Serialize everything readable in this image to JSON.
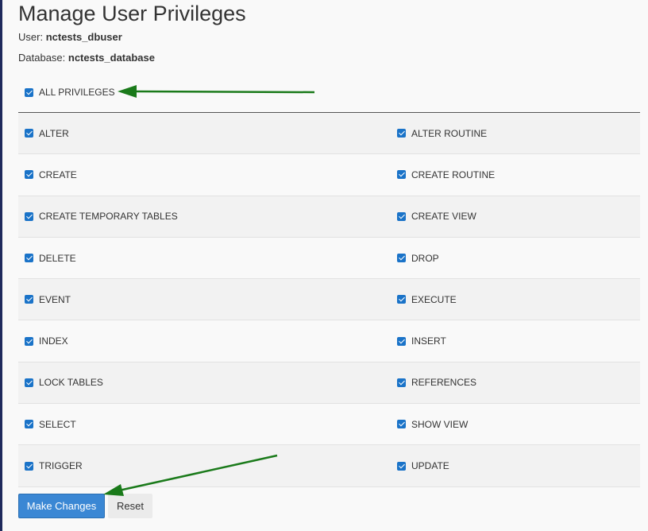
{
  "page": {
    "title": "Manage User Privileges",
    "user_label": "User:",
    "user_value": "nctests_dbuser",
    "database_label": "Database:",
    "database_value": "nctests_database"
  },
  "all_privileges": {
    "label": "ALL PRIVILEGES",
    "checked": true
  },
  "privileges": {
    "rows": [
      {
        "left": {
          "label": "ALTER",
          "checked": true
        },
        "right": {
          "label": "ALTER ROUTINE",
          "checked": true
        }
      },
      {
        "left": {
          "label": "CREATE",
          "checked": true
        },
        "right": {
          "label": "CREATE ROUTINE",
          "checked": true
        }
      },
      {
        "left": {
          "label": "CREATE TEMPORARY TABLES",
          "checked": true
        },
        "right": {
          "label": "CREATE VIEW",
          "checked": true
        }
      },
      {
        "left": {
          "label": "DELETE",
          "checked": true
        },
        "right": {
          "label": "DROP",
          "checked": true
        }
      },
      {
        "left": {
          "label": "EVENT",
          "checked": true
        },
        "right": {
          "label": "EXECUTE",
          "checked": true
        }
      },
      {
        "left": {
          "label": "INDEX",
          "checked": true
        },
        "right": {
          "label": "INSERT",
          "checked": true
        }
      },
      {
        "left": {
          "label": "LOCK TABLES",
          "checked": true
        },
        "right": {
          "label": "REFERENCES",
          "checked": true
        }
      },
      {
        "left": {
          "label": "SELECT",
          "checked": true
        },
        "right": {
          "label": "SHOW VIEW",
          "checked": true
        }
      },
      {
        "left": {
          "label": "TRIGGER",
          "checked": true
        },
        "right": {
          "label": "UPDATE",
          "checked": true
        }
      }
    ]
  },
  "actions": {
    "make_changes_label": "Make Changes",
    "reset_label": "Reset"
  },
  "colors": {
    "primary_button": "#3a87d4",
    "checkbox": "#1a73c8",
    "annotation_arrow": "#1a7a1a"
  },
  "icons": {
    "checkbox": "checkbox-checked-icon",
    "annotation": "arrow-annotation-icon"
  }
}
